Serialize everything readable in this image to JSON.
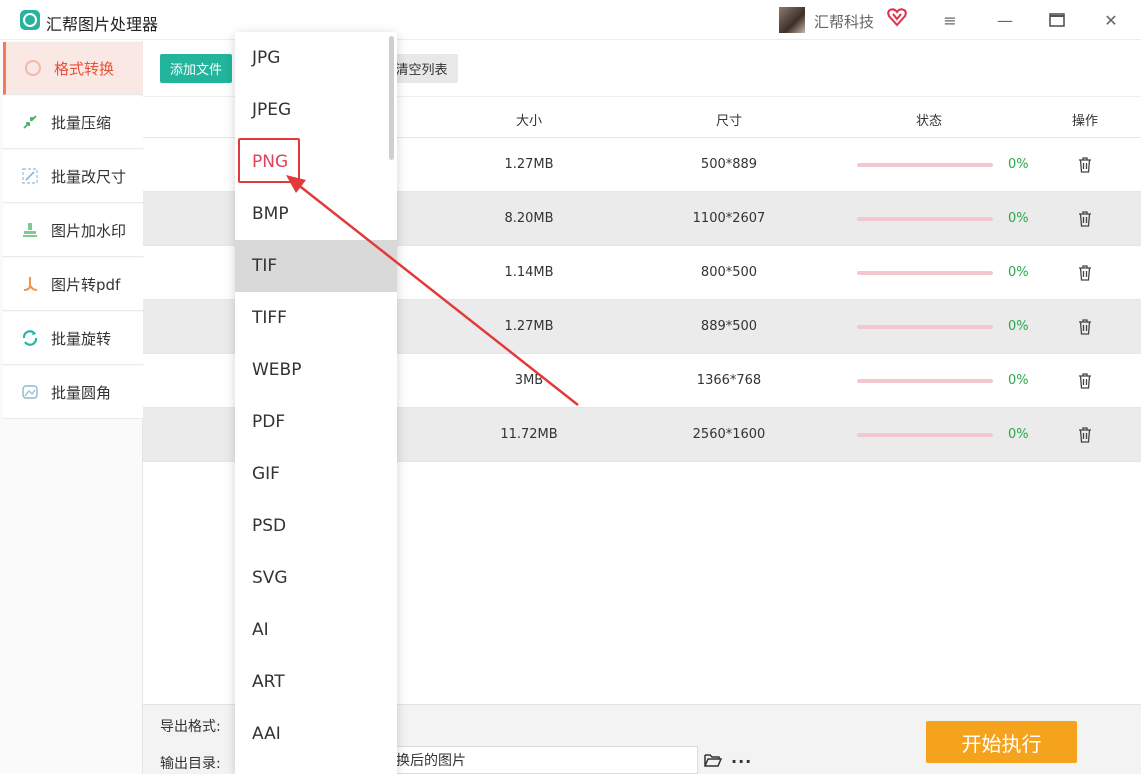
{
  "titlebar": {
    "app_title": "汇帮图片处理器",
    "user_name": "汇帮科技",
    "menu_icon": "menu-icon",
    "minimize_icon": "minimize-icon",
    "maximize_icon": "maximize-icon",
    "close_icon": "close-icon"
  },
  "sidebar": {
    "items": [
      {
        "label": "格式转换",
        "icon": "convert-icon",
        "active": true
      },
      {
        "label": "批量压缩",
        "icon": "compress-icon",
        "active": false
      },
      {
        "label": "批量改尺寸",
        "icon": "resize-icon",
        "active": false
      },
      {
        "label": "图片加水印",
        "icon": "watermark-icon",
        "active": false
      },
      {
        "label": "图片转pdf",
        "icon": "pdf-icon",
        "active": false
      },
      {
        "label": "批量旋转",
        "icon": "rotate-icon",
        "active": false
      },
      {
        "label": "批量圆角",
        "icon": "round-corner-icon",
        "active": false
      }
    ]
  },
  "toolbar": {
    "add_label": "添加文件",
    "clear_label": "清空列表"
  },
  "table": {
    "headers": [
      "大小",
      "尺寸",
      "状态",
      "操作"
    ],
    "rows": [
      {
        "size": "1.27MB",
        "dimension": "500*889",
        "progress": 0,
        "percent": "0%"
      },
      {
        "size": "8.20MB",
        "dimension": "1100*2607",
        "progress": 0,
        "percent": "0%"
      },
      {
        "size": "1.14MB",
        "dimension": "800*500",
        "progress": 0,
        "percent": "0%"
      },
      {
        "size": "1.27MB",
        "dimension": "889*500",
        "progress": 0,
        "percent": "0%"
      },
      {
        "size": "3MB",
        "dimension": "1366*768",
        "progress": 0,
        "percent": "0%"
      },
      {
        "size": "11.72MB",
        "dimension": "2560*1600",
        "progress": 0,
        "percent": "0%"
      }
    ]
  },
  "bottom": {
    "export_format_label": "导出格式:",
    "output_dir_label": "输出目录:",
    "output_dir_value": "换后的图片",
    "more_label": "···",
    "start_label": "开始执行"
  },
  "dropdown": {
    "options": [
      "JPG",
      "JPEG",
      "PNG",
      "BMP",
      "TIF",
      "TIFF",
      "WEBP",
      "PDF",
      "GIF",
      "PSD",
      "SVG",
      "AI",
      "ART",
      "AAI"
    ],
    "selected": "PNG",
    "hovered": "TIF"
  },
  "colors": {
    "accent_teal": "#22b49c",
    "accent_orange": "#f5a31c",
    "active_red": "#e8513a",
    "progress_green": "#29a84a",
    "annotation_red": "#e23a3a"
  }
}
